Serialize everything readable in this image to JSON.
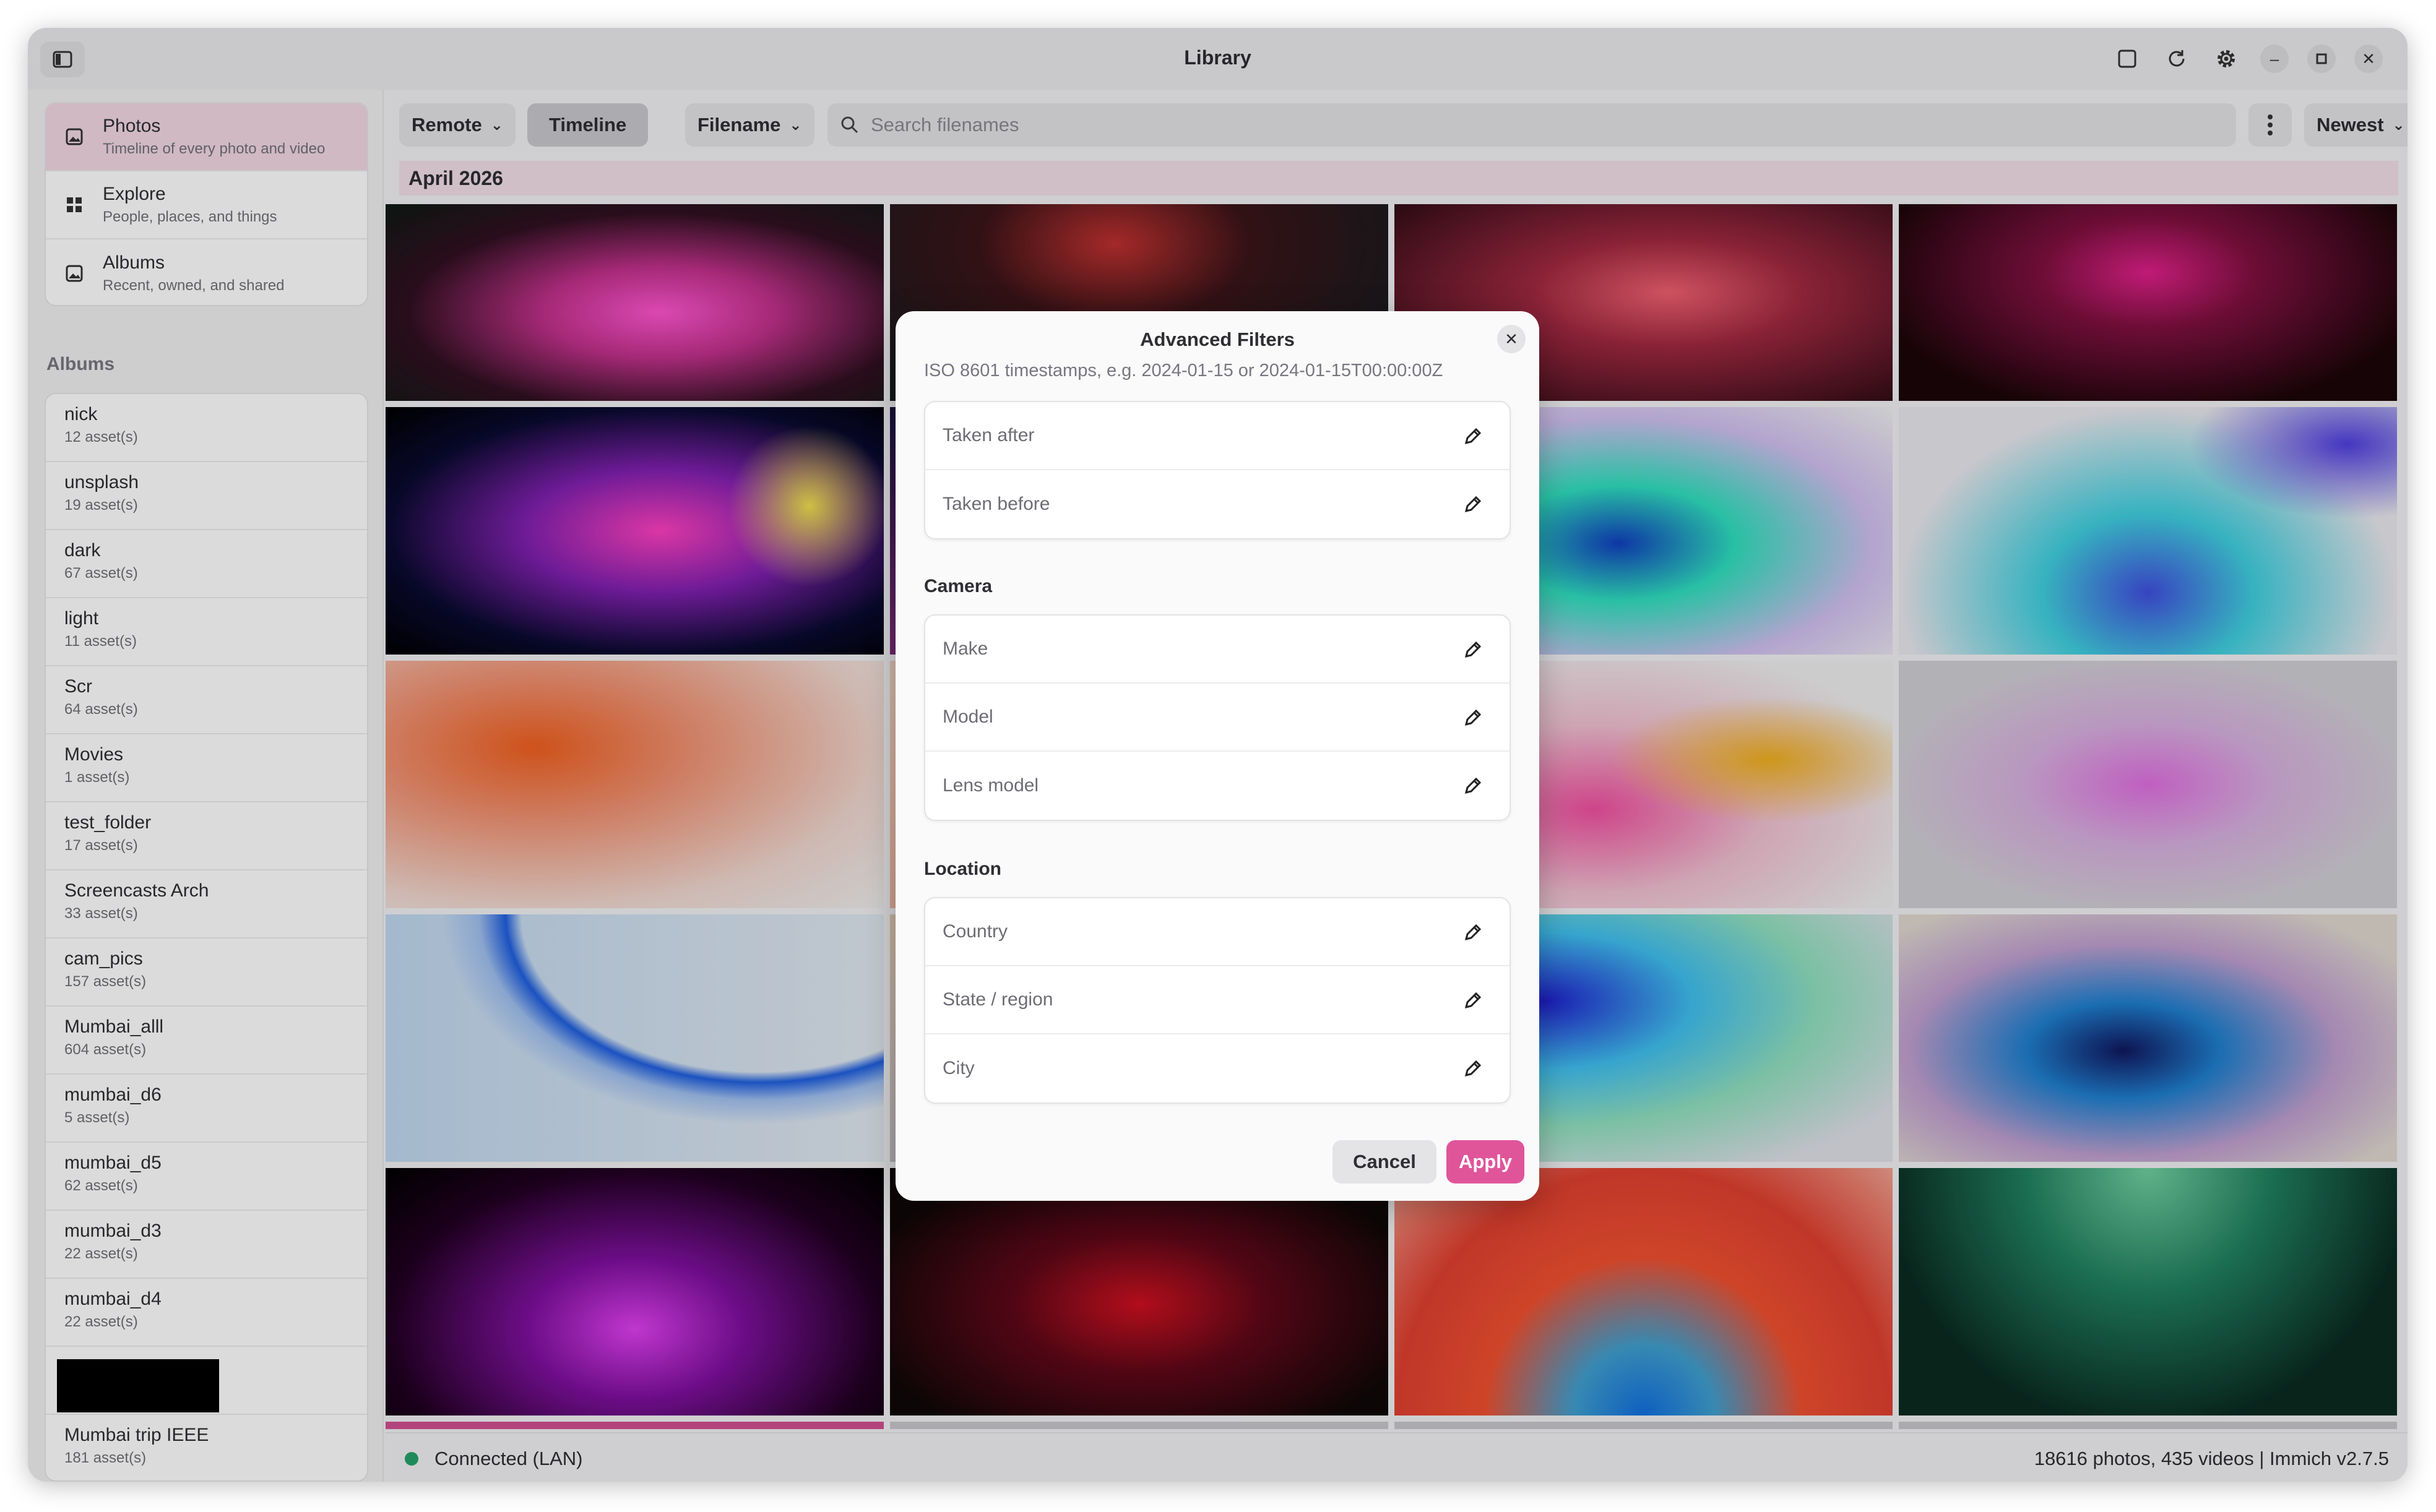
{
  "window": {
    "title": "Library"
  },
  "sidebar": {
    "nav": [
      {
        "label": "Photos",
        "subtitle": "Timeline of every photo and video",
        "icon": "photo-icon"
      },
      {
        "label": "Explore",
        "subtitle": "People, places, and things",
        "icon": "grid-icon"
      },
      {
        "label": "Albums",
        "subtitle": "Recent, owned, and shared",
        "icon": "album-icon"
      }
    ],
    "albums_heading": "Albums",
    "albums": [
      {
        "name": "nick",
        "count": "12 asset(s)"
      },
      {
        "name": "unsplash",
        "count": "19 asset(s)"
      },
      {
        "name": "dark",
        "count": "67 asset(s)"
      },
      {
        "name": "light",
        "count": "11 asset(s)"
      },
      {
        "name": "Scr",
        "count": "64 asset(s)"
      },
      {
        "name": "Movies",
        "count": "1 asset(s)"
      },
      {
        "name": "test_folder",
        "count": "17 asset(s)"
      },
      {
        "name": "Screencasts Arch",
        "count": "33 asset(s)"
      },
      {
        "name": "cam_pics",
        "count": "157 asset(s)"
      },
      {
        "name": "Mumbai_alll",
        "count": "604 asset(s)"
      },
      {
        "name": "mumbai_d6",
        "count": "5 asset(s)"
      },
      {
        "name": "mumbai_d5",
        "count": "62 asset(s)"
      },
      {
        "name": "mumbai_d3",
        "count": "22 asset(s)"
      },
      {
        "name": "mumbai_d4",
        "count": "22 asset(s)"
      }
    ],
    "last_album": {
      "name": "Mumbai trip IEEE",
      "count": "181 asset(s)"
    }
  },
  "toolbar": {
    "source": "Remote",
    "view": "Timeline",
    "field": "Filename",
    "search_placeholder": "Search filenames",
    "sort": "Newest"
  },
  "timeline": {
    "month": "April 2026"
  },
  "status": {
    "connection": "Connected (LAN)",
    "stats": "18616 photos, 435 videos | Immich v2.7.5",
    "connection_color": "#26a269"
  },
  "dialog": {
    "title": "Advanced Filters",
    "hint": "ISO 8601 timestamps, e.g. 2024-01-15 or 2024-01-15T00:00:00Z",
    "date_fields": [
      "Taken after",
      "Taken before"
    ],
    "camera_heading": "Camera",
    "camera_fields": [
      "Make",
      "Model",
      "Lens model"
    ],
    "location_heading": "Location",
    "location_fields": [
      "Country",
      "State / region",
      "City"
    ],
    "cancel_label": "Cancel",
    "apply_label": "Apply",
    "accent_color": "#e0559a"
  }
}
